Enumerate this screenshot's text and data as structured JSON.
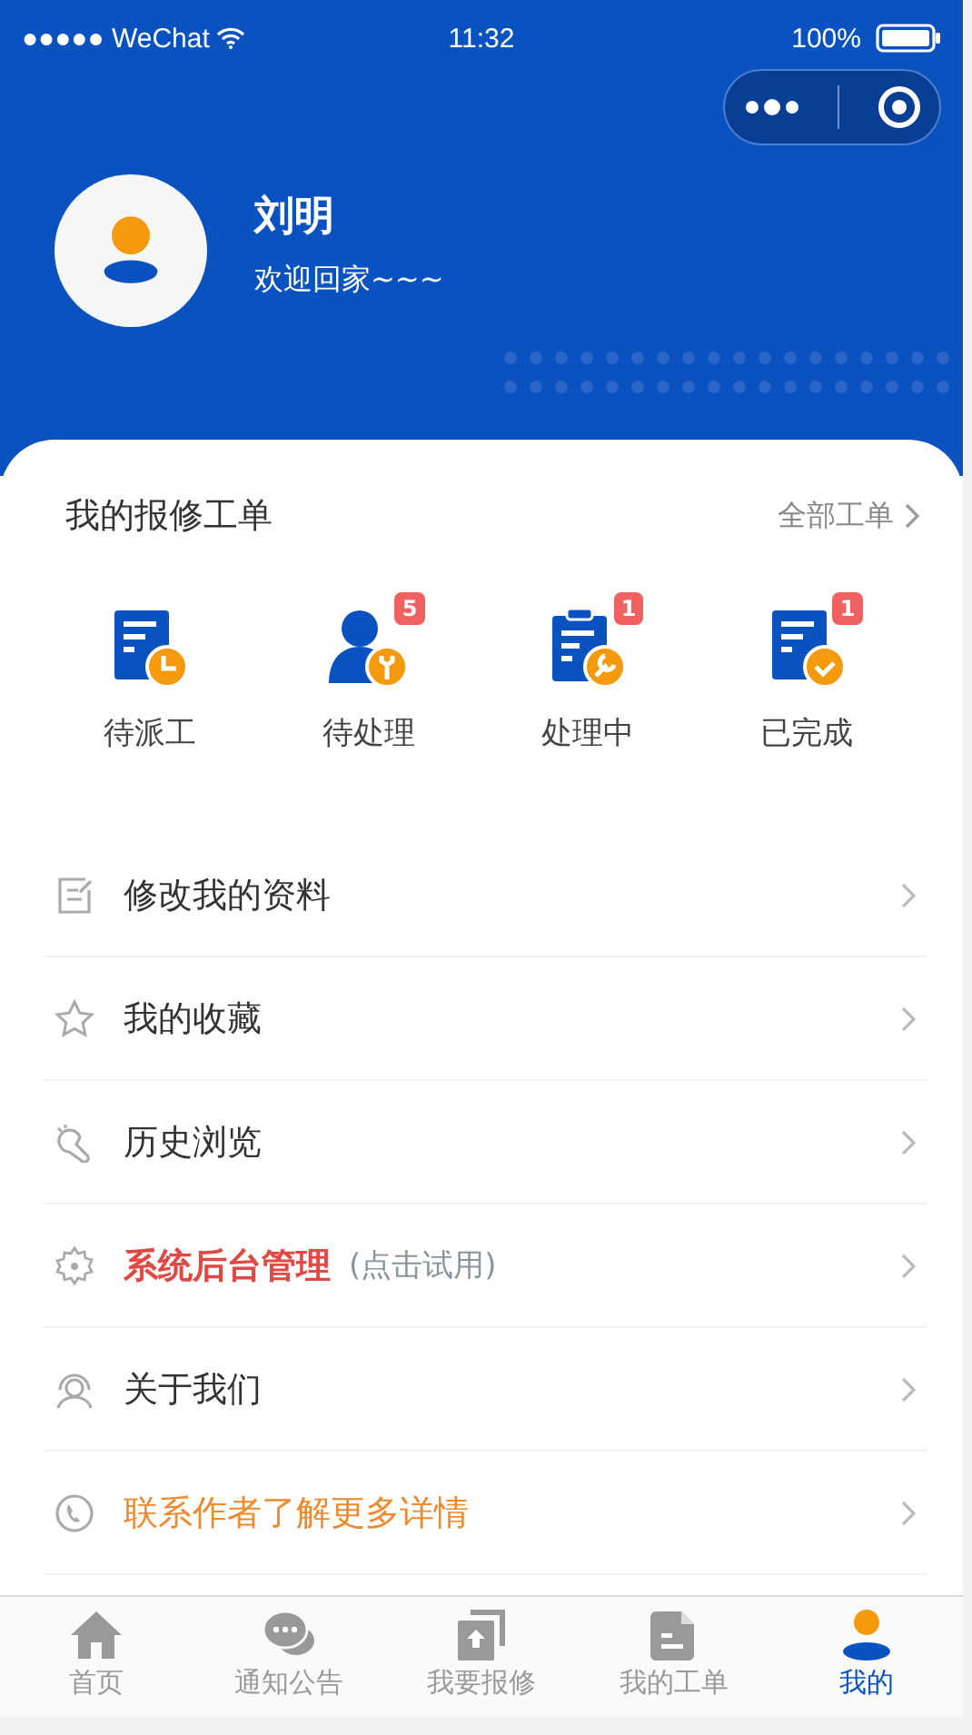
{
  "status_bar": {
    "carrier": "●●●●● WeChat",
    "time": "11:32",
    "battery": "100%"
  },
  "profile": {
    "name": "刘明",
    "greeting": "欢迎回家~~~"
  },
  "orders": {
    "title": "我的报修工单",
    "all_link": "全部工单",
    "items": [
      {
        "kind": "pending_dispatch",
        "label": "待派工"
      },
      {
        "kind": "pending",
        "label": "待处理",
        "badge": "5"
      },
      {
        "kind": "processing",
        "label": "处理中",
        "badge": "1"
      },
      {
        "kind": "done",
        "label": "已完成",
        "badge": "1"
      }
    ]
  },
  "menu": [
    {
      "kind": "edit",
      "label": "修改我的资料"
    },
    {
      "kind": "star",
      "label": "我的收藏"
    },
    {
      "kind": "history",
      "label": "历史浏览"
    },
    {
      "kind": "gear",
      "label": "系统后台管理",
      "hint": "(点击试用)"
    },
    {
      "kind": "support",
      "label": "关于我们"
    },
    {
      "kind": "phone",
      "label": "联系作者了解更多详情"
    }
  ],
  "tab_bar": [
    {
      "kind": "home",
      "label": "首页",
      "selected": false
    },
    {
      "kind": "chat",
      "label": "通知公告",
      "selected": false
    },
    {
      "kind": "upload",
      "label": "我要报修",
      "selected": false
    },
    {
      "kind": "doc",
      "label": "我的工单",
      "selected": false
    },
    {
      "kind": "user",
      "label": "我的",
      "selected": true
    }
  ]
}
